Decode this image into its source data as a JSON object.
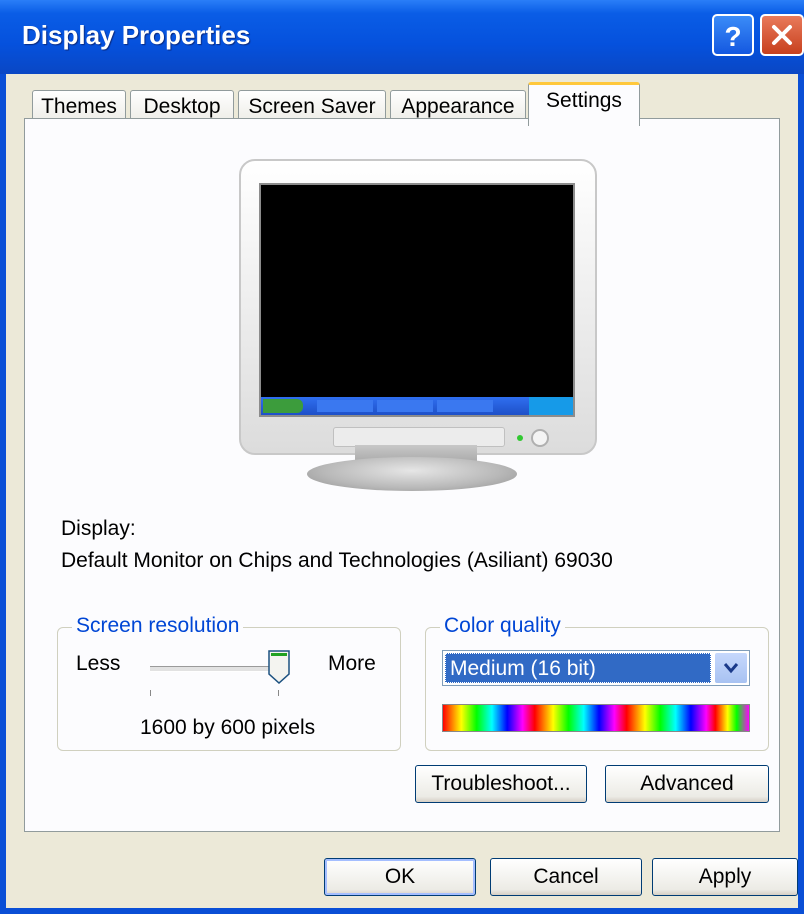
{
  "window": {
    "title": "Display Properties",
    "icons": {
      "help": "help-icon",
      "close": "close-icon"
    }
  },
  "tabs": [
    {
      "label": "Themes"
    },
    {
      "label": "Desktop"
    },
    {
      "label": "Screen Saver"
    },
    {
      "label": "Appearance"
    },
    {
      "label": "Settings",
      "active": true
    }
  ],
  "display": {
    "label": "Display:",
    "value": "Default Monitor on Chips and Technologies (Asiliant) 69030"
  },
  "resolution": {
    "group_label": "Screen resolution",
    "less_label": "Less",
    "more_label": "More",
    "value_text": "1600 by 600 pixels",
    "slider_level": 1.0
  },
  "color_quality": {
    "group_label": "Color quality",
    "selected": "Medium (16 bit)"
  },
  "buttons": {
    "troubleshoot": "Troubleshoot...",
    "advanced": "Advanced",
    "ok": "OK",
    "cancel": "Cancel",
    "apply": "Apply"
  },
  "colors": {
    "titlebar": "#0551dd",
    "client": "#ece9d8",
    "accent_tab": "#ffc83c",
    "selection": "#316ac5"
  }
}
